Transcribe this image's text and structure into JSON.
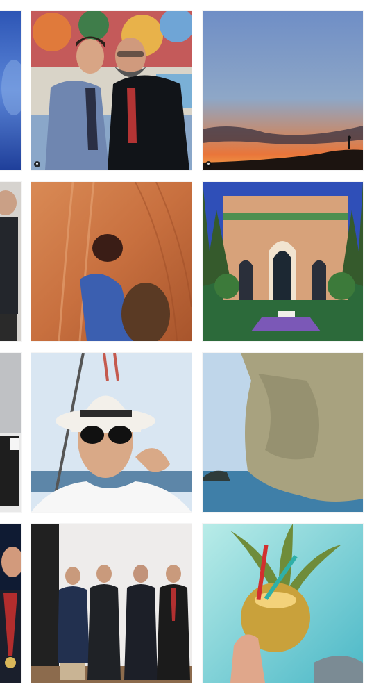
{
  "grid": {
    "rows": 4,
    "columns": 3,
    "tiles": [
      {
        "name": "partial-blue-photo"
      },
      {
        "name": "two-men-event-photo",
        "badge": "igtv-icon"
      },
      {
        "name": "desert-sunset-silhouette-photo",
        "badge": "igtv-icon"
      },
      {
        "name": "partial-man-suit-photo"
      },
      {
        "name": "desert-camel-rider-photo"
      },
      {
        "name": "moroccan-palace-photo"
      },
      {
        "name": "partial-white-room-photo"
      },
      {
        "name": "selfie-hat-sunglasses-photo"
      },
      {
        "name": "sea-cliff-photo"
      },
      {
        "name": "partial-man-medal-photo"
      },
      {
        "name": "group-four-men-photo"
      },
      {
        "name": "pineapple-drink-photo"
      }
    ]
  },
  "colors": {
    "background": "#ffffff",
    "desert_orange": "#c8703f",
    "sky_blue": "#5a86c7",
    "sea_blue": "#3f7fa8",
    "sunset_orange": "#e9753a"
  }
}
